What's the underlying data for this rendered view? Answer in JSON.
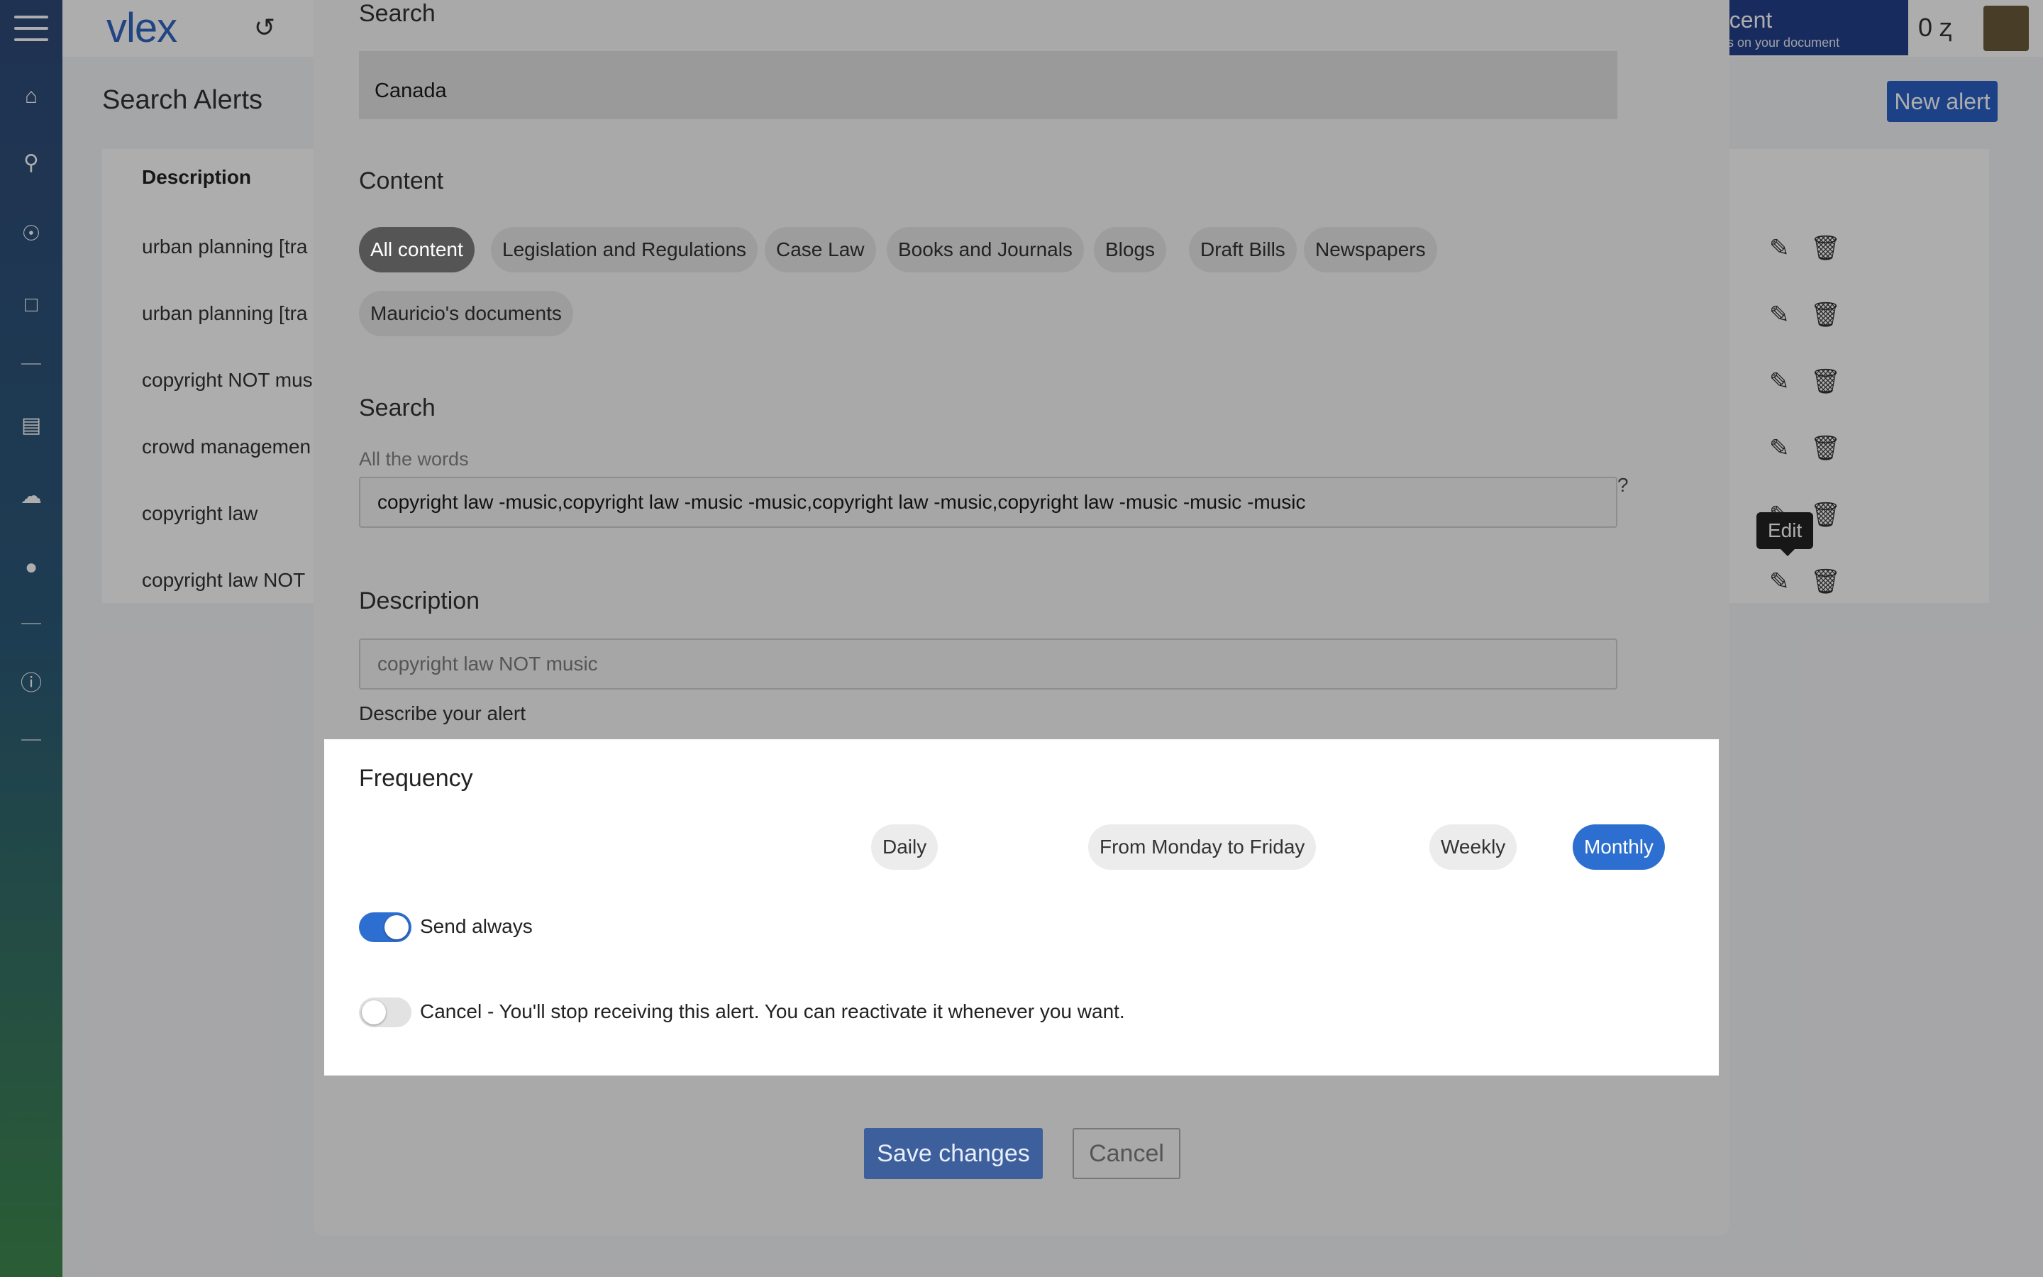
{
  "app": {
    "logo": "vlex",
    "promo_title": "ncent",
    "promo_subtitle": "hts on your document",
    "credits": "0 ⱬ"
  },
  "background_page": {
    "title": "Search Alerts",
    "new_alert_label": "New alert",
    "column_description": "Description",
    "rows": [
      "urban planning [tra",
      "urban planning [tra",
      "copyright NOT mus",
      "crowd managemen",
      "copyright law",
      "copyright law NOT"
    ],
    "tooltip": "Edit"
  },
  "modal": {
    "search_section_title": "Search",
    "country_value": "Canada",
    "content_title": "Content",
    "content_chips": [
      "All content",
      "Legislation and Regulations",
      "Case Law",
      "Books and Journals",
      "Blogs",
      "Draft Bills",
      "Newspapers",
      "Mauricio's documents"
    ],
    "content_active": "All content",
    "search_title": "Search",
    "all_words_label": "All the words",
    "all_words_value": "copyright law -music,copyright law -music -music,copyright law -music,copyright law -music -music -music",
    "help_mark": "?",
    "description_title": "Description",
    "description_placeholder": "copyright law NOT music",
    "description_hint": "Describe your alert",
    "frequency": {
      "title": "Frequency",
      "options": [
        "Daily",
        "From Monday to Friday",
        "Weekly",
        "Monthly"
      ],
      "selected": "Monthly",
      "send_always_label": "Send always",
      "send_always_on": true,
      "cancel_label": "Cancel - You'll stop receiving this alert. You can reactivate it whenever you want.",
      "cancel_on": false
    },
    "save_label": "Save changes",
    "cancel_label": "Cancel"
  },
  "colors": {
    "accent": "#2d6fd0",
    "brand": "#3166c2"
  }
}
